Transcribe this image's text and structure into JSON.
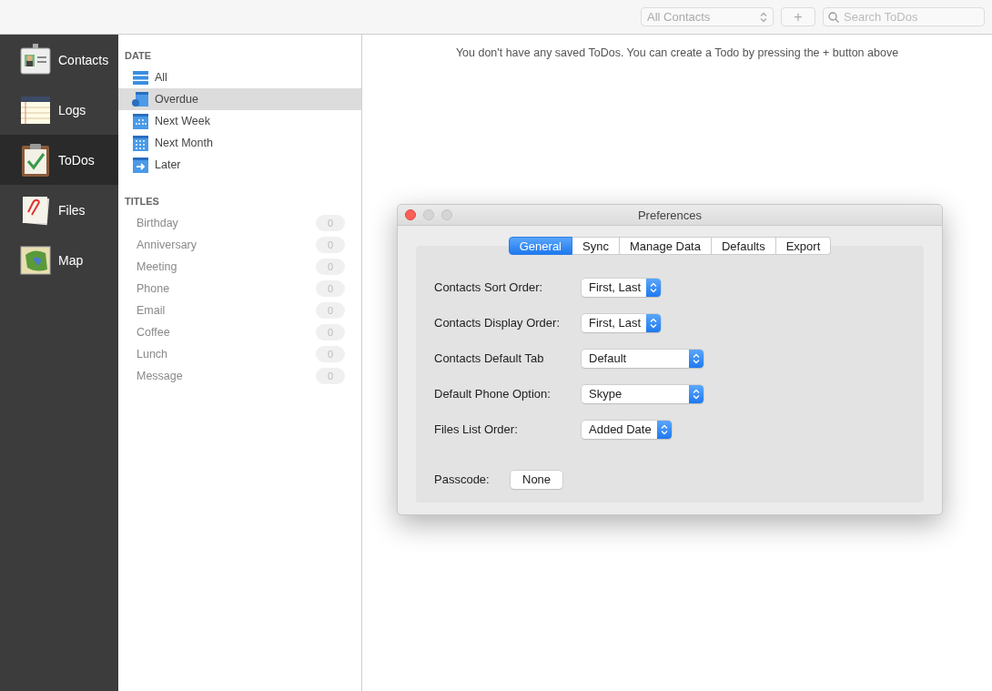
{
  "toolbar": {
    "contacts_filter": {
      "value": "All Contacts"
    },
    "add_button": {
      "label": "+"
    },
    "search": {
      "placeholder": "Search ToDos"
    }
  },
  "sidebar": {
    "items": [
      {
        "label": "Contacts",
        "selected": false
      },
      {
        "label": "Logs",
        "selected": false
      },
      {
        "label": "ToDos",
        "selected": true
      },
      {
        "label": "Files",
        "selected": false
      },
      {
        "label": "Map",
        "selected": false
      }
    ]
  },
  "list": {
    "sections": [
      {
        "title": "DATE",
        "kind": "date",
        "items": [
          {
            "label": "All",
            "selected": false
          },
          {
            "label": "Overdue",
            "selected": true
          },
          {
            "label": "Next Week",
            "selected": false
          },
          {
            "label": "Next Month",
            "selected": false
          },
          {
            "label": "Later",
            "selected": false
          }
        ]
      },
      {
        "title": "TITLES",
        "kind": "titles",
        "items": [
          {
            "label": "Birthday",
            "count": "0"
          },
          {
            "label": "Anniversary",
            "count": "0"
          },
          {
            "label": "Meeting",
            "count": "0"
          },
          {
            "label": "Phone",
            "count": "0"
          },
          {
            "label": "Email",
            "count": "0"
          },
          {
            "label": "Coffee",
            "count": "0"
          },
          {
            "label": "Lunch",
            "count": "0"
          },
          {
            "label": "Message",
            "count": "0"
          }
        ]
      }
    ]
  },
  "main": {
    "empty_message": "You don't have any saved ToDos. You can create a Todo by pressing the + button above"
  },
  "preferences": {
    "title": "Preferences",
    "tabs": [
      {
        "label": "General",
        "selected": true
      },
      {
        "label": "Sync",
        "selected": false
      },
      {
        "label": "Manage Data",
        "selected": false
      },
      {
        "label": "Defaults",
        "selected": false
      },
      {
        "label": "Export",
        "selected": false
      }
    ],
    "settings": [
      {
        "kind": "popup",
        "label": "Contacts Sort Order:",
        "value": "First, Last"
      },
      {
        "kind": "popup",
        "label": "Contacts Display Order:",
        "value": "First, Last"
      },
      {
        "kind": "popup",
        "label": "Contacts Default Tab",
        "value": "Default"
      },
      {
        "kind": "popup",
        "label": "Default Phone Option:",
        "value": "Skype"
      },
      {
        "kind": "popup",
        "label": "Files List Order:",
        "value": "Added Date"
      },
      {
        "kind": "button",
        "label": "Passcode:",
        "value": "None"
      }
    ]
  }
}
